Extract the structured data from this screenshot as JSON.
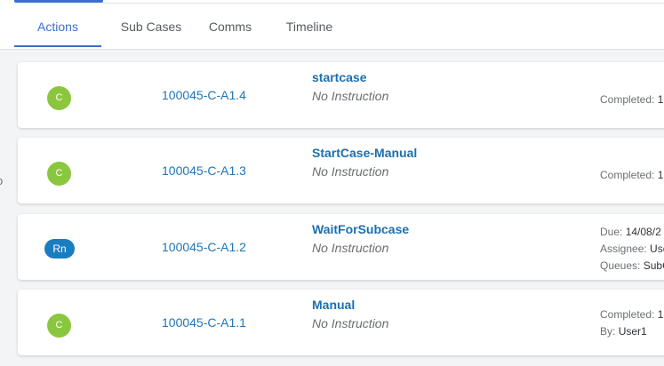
{
  "tabs": [
    {
      "label": "Actions",
      "active": true
    },
    {
      "label": "Sub Cases"
    },
    {
      "label": "Comms"
    },
    {
      "label": "Timeline"
    }
  ],
  "side_glyph": "o",
  "actions": [
    {
      "status": "C",
      "status_color": "#8bc63f",
      "id": "100045-C-A1.4",
      "name": "startcase",
      "instruction": "No Instruction",
      "completed_label": "Completed:",
      "completed_value": "1"
    },
    {
      "status": "C",
      "status_color": "#8bc63f",
      "id": "100045-C-A1.3",
      "name": "StartCase-Manual",
      "instruction": "No Instruction",
      "completed_label": "Completed:",
      "completed_value": "1"
    },
    {
      "status": "Rn",
      "status_color": "#1a7dc0",
      "id": "100045-C-A1.2",
      "name": "WaitForSubcase",
      "instruction": "No Instruction",
      "due_label": "Due:",
      "due_value": "14/08/2",
      "assignee_label": "Assignee:",
      "assignee_value": "Use",
      "queues_label": "Queues:",
      "queues_value": "SubC"
    },
    {
      "status": "C",
      "status_color": "#8bc63f",
      "id": "100045-C-A1.1",
      "name": "Manual",
      "instruction": "No Instruction",
      "completed_label": "Completed:",
      "completed_value": "1",
      "by_label": "By:",
      "by_value": "User1"
    }
  ]
}
